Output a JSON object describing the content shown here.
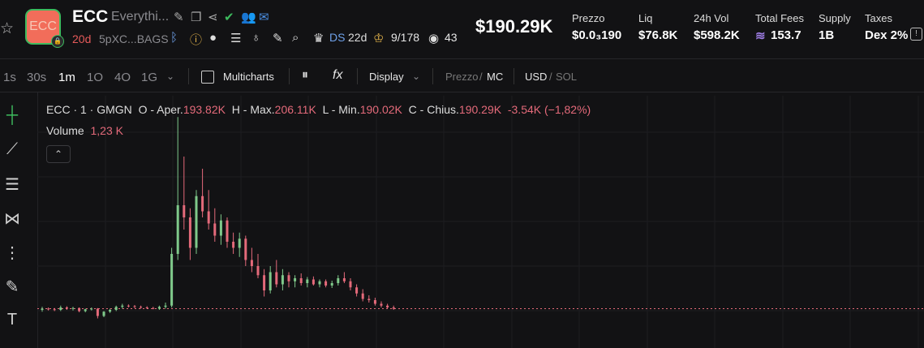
{
  "header": {
    "symbol": "ECC",
    "logo_text": "ECC",
    "name": "Everythi...",
    "age": "20d",
    "address": "5pXC...BAGS",
    "ds_label": "DS",
    "ds_age": "22d",
    "holders": "9/178",
    "views": "43",
    "price": "$190.29K",
    "stats": [
      {
        "label": "Prezzo",
        "value": "$0.0₃190"
      },
      {
        "label": "Liq",
        "value": "$76.8K"
      },
      {
        "label": "24h Vol",
        "value": "$598.2K"
      },
      {
        "label": "Total Fees",
        "value": "153.7"
      },
      {
        "label": "Supply",
        "value": "1B"
      },
      {
        "label": "Taxes",
        "value": "Dex 2%"
      }
    ]
  },
  "toolbar": {
    "timeframes": [
      "1s",
      "30s",
      "1m",
      "1O",
      "4O",
      "1G"
    ],
    "active_timeframe": "1m",
    "multicharts": "Multicharts",
    "display": "Display",
    "price_label": "Prezzo",
    "mc_label": "MC",
    "usd_label": "USD",
    "sol_label": "SOL"
  },
  "legend": {
    "title": "ECC · 1 · GMGN",
    "o_label": "O - Aper.",
    "o_value": "193.82K",
    "h_label": "H - Max.",
    "h_value": "206.11K",
    "l_label": "L - Min.",
    "l_value": "190.02K",
    "c_label": "C - Chius.",
    "c_value": "190.29K",
    "change": "-3.54K (−1,82%)",
    "volume_label": "Volume",
    "volume_value": "1,23 K"
  },
  "colors": {
    "up": "#7fc98a",
    "down": "#e46a7a",
    "accent": "#3dbb5e",
    "background": "#121214"
  },
  "chart_data": {
    "type": "candlestick",
    "interval": "1m",
    "series": [
      {
        "name": "ECC · 1 · GMGN",
        "values": [
          {
            "o": 48,
            "h": 53,
            "l": 45,
            "c": 50
          },
          {
            "o": 50,
            "h": 52,
            "l": 47,
            "c": 49
          },
          {
            "o": 49,
            "h": 51,
            "l": 46,
            "c": 48
          },
          {
            "o": 48,
            "h": 55,
            "l": 46,
            "c": 52
          },
          {
            "o": 52,
            "h": 54,
            "l": 48,
            "c": 50
          },
          {
            "o": 50,
            "h": 53,
            "l": 47,
            "c": 51
          },
          {
            "o": 51,
            "h": 52,
            "l": 44,
            "c": 46
          },
          {
            "o": 46,
            "h": 50,
            "l": 44,
            "c": 49
          },
          {
            "o": 49,
            "h": 52,
            "l": 47,
            "c": 50
          },
          {
            "o": 50,
            "h": 51,
            "l": 34,
            "c": 38
          },
          {
            "o": 38,
            "h": 46,
            "l": 36,
            "c": 45
          },
          {
            "o": 45,
            "h": 50,
            "l": 43,
            "c": 48
          },
          {
            "o": 48,
            "h": 55,
            "l": 46,
            "c": 53
          },
          {
            "o": 53,
            "h": 58,
            "l": 50,
            "c": 55
          },
          {
            "o": 55,
            "h": 57,
            "l": 52,
            "c": 54
          },
          {
            "o": 54,
            "h": 56,
            "l": 51,
            "c": 53
          },
          {
            "o": 53,
            "h": 55,
            "l": 50,
            "c": 52
          },
          {
            "o": 52,
            "h": 54,
            "l": 50,
            "c": 51
          },
          {
            "o": 51,
            "h": 53,
            "l": 49,
            "c": 50
          },
          {
            "o": 50,
            "h": 55,
            "l": 48,
            "c": 53
          },
          {
            "o": 53,
            "h": 60,
            "l": 50,
            "c": 55
          },
          {
            "o": 55,
            "h": 150,
            "l": 52,
            "c": 140
          },
          {
            "o": 140,
            "h": 365,
            "l": 130,
            "c": 220
          },
          {
            "o": 220,
            "h": 300,
            "l": 180,
            "c": 200
          },
          {
            "o": 200,
            "h": 215,
            "l": 130,
            "c": 150
          },
          {
            "o": 150,
            "h": 245,
            "l": 140,
            "c": 235
          },
          {
            "o": 235,
            "h": 280,
            "l": 200,
            "c": 210
          },
          {
            "o": 210,
            "h": 245,
            "l": 180,
            "c": 190
          },
          {
            "o": 190,
            "h": 215,
            "l": 160,
            "c": 170
          },
          {
            "o": 170,
            "h": 205,
            "l": 155,
            "c": 195
          },
          {
            "o": 195,
            "h": 200,
            "l": 150,
            "c": 160
          },
          {
            "o": 160,
            "h": 175,
            "l": 140,
            "c": 150
          },
          {
            "o": 150,
            "h": 175,
            "l": 135,
            "c": 165
          },
          {
            "o": 165,
            "h": 170,
            "l": 120,
            "c": 130
          },
          {
            "o": 130,
            "h": 150,
            "l": 110,
            "c": 120
          },
          {
            "o": 120,
            "h": 140,
            "l": 100,
            "c": 105
          },
          {
            "o": 105,
            "h": 115,
            "l": 70,
            "c": 80
          },
          {
            "o": 80,
            "h": 120,
            "l": 75,
            "c": 110
          },
          {
            "o": 110,
            "h": 130,
            "l": 85,
            "c": 90
          },
          {
            "o": 90,
            "h": 115,
            "l": 80,
            "c": 105
          },
          {
            "o": 105,
            "h": 110,
            "l": 85,
            "c": 95
          },
          {
            "o": 95,
            "h": 105,
            "l": 85,
            "c": 100
          },
          {
            "o": 100,
            "h": 108,
            "l": 88,
            "c": 92
          },
          {
            "o": 92,
            "h": 102,
            "l": 85,
            "c": 98
          },
          {
            "o": 98,
            "h": 103,
            "l": 88,
            "c": 90
          },
          {
            "o": 90,
            "h": 98,
            "l": 85,
            "c": 95
          },
          {
            "o": 95,
            "h": 98,
            "l": 85,
            "c": 88
          },
          {
            "o": 88,
            "h": 96,
            "l": 84,
            "c": 92
          },
          {
            "o": 92,
            "h": 105,
            "l": 88,
            "c": 100
          },
          {
            "o": 100,
            "h": 110,
            "l": 92,
            "c": 95
          },
          {
            "o": 95,
            "h": 100,
            "l": 80,
            "c": 85
          },
          {
            "o": 85,
            "h": 90,
            "l": 70,
            "c": 75
          },
          {
            "o": 75,
            "h": 82,
            "l": 62,
            "c": 66
          },
          {
            "o": 66,
            "h": 72,
            "l": 60,
            "c": 64
          },
          {
            "o": 64,
            "h": 68,
            "l": 55,
            "c": 58
          },
          {
            "o": 58,
            "h": 62,
            "l": 52,
            "c": 55
          },
          {
            "o": 55,
            "h": 58,
            "l": 50,
            "c": 52
          },
          {
            "o": 52,
            "h": 55,
            "l": 48,
            "c": 50
          }
        ]
      }
    ],
    "ylim": [
      0,
      400
    ],
    "last_value_line": 50,
    "grid": true
  }
}
